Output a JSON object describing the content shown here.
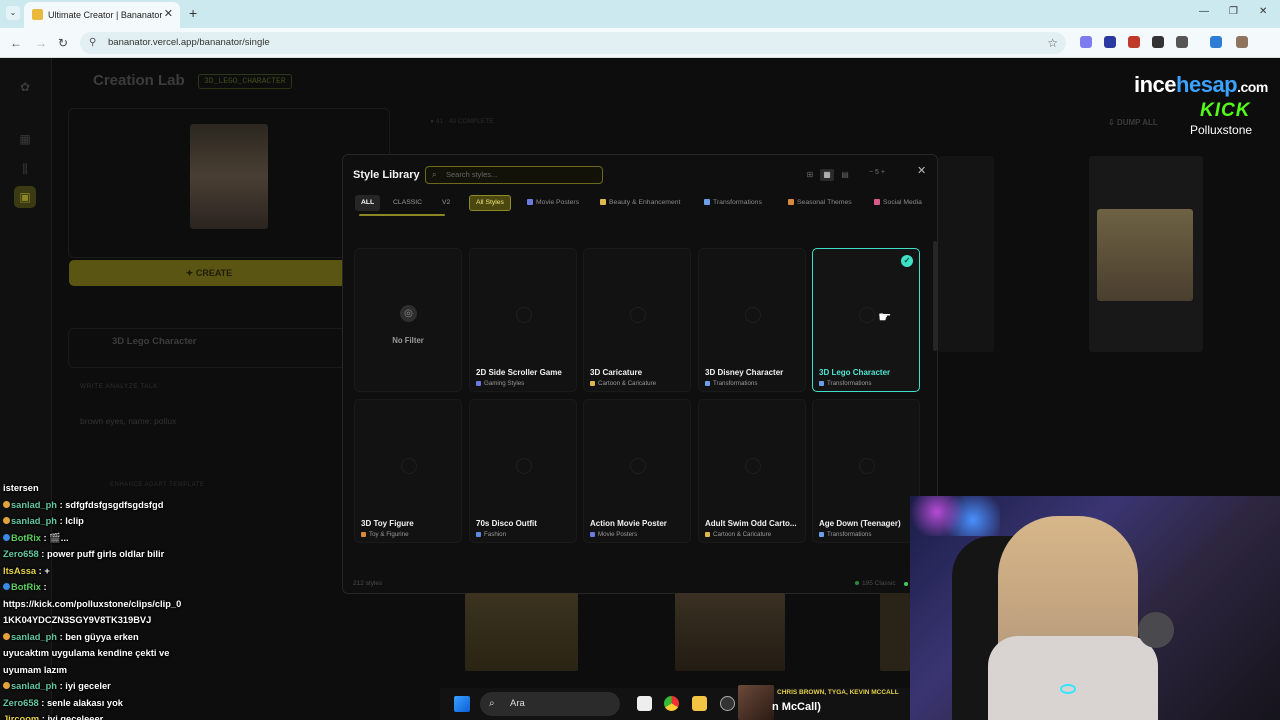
{
  "browser": {
    "tab_title": "Ultimate Creator | Bananator",
    "url": "bananator.vercel.app/bananator/single",
    "new_tab": "+",
    "tab_close": "✕",
    "menu_glyph": "⌄",
    "minimize": "—",
    "restore": "❐",
    "close": "✕",
    "back_icon": "←",
    "forward_icon": "→",
    "reload_icon": "↻",
    "tune_icon": "⚲",
    "star_icon": "☆",
    "extension_colors": [
      "#7c7cf0",
      "#2a3aa0",
      "#c0392b",
      "#333333",
      "#555555",
      "#2e7dd6",
      "#8d7560"
    ]
  },
  "lab": {
    "title": "Creation Lab",
    "badge": "3D_LEGO_CHARACTER",
    "create_label": "✦  CREATE",
    "style_name": "3D Lego Character",
    "tabs": "WRITE        ANALYZE        TALK",
    "prompt": "brown eyes, name: pollux",
    "tools": "ENHANCE                                           ADAPT                                   TEMPLATE",
    "gallery_meta": "● 41  ·  43  COMPLETE",
    "dump_all": "⇩  DUMP ALL"
  },
  "overlay": {
    "brand_a": "ince",
    "brand_b": "hesap",
    "brand_c": ".com",
    "kick": "KICK",
    "streamer": "Polluxstone"
  },
  "modal": {
    "title": "Style Library",
    "search_placeholder": "Search styles...",
    "search_icon": "⌕",
    "close": "✕",
    "view_small": "⊞",
    "view_medium": "▦",
    "view_list": "▤",
    "stepper": "−   5   +",
    "filters": [
      "ALL",
      "CLASSIC",
      "V2"
    ],
    "all_styles": "All Styles",
    "categories": [
      {
        "label": "Movie Posters",
        "color": "#6c7ae0"
      },
      {
        "label": "Beauty & Enhancement",
        "color": "#e0b84a"
      },
      {
        "label": "Transformations",
        "color": "#6aa0e8"
      },
      {
        "label": "Seasonal Themes",
        "color": "#d88a3a"
      },
      {
        "label": "Social Media",
        "color": "#d85a8a"
      }
    ],
    "no_filter": "No Filter",
    "no_filter_icon": "◎",
    "check_icon": "✓",
    "cards_row1": [
      {
        "title": "2D Side Scroller Game",
        "category": "Gaming Styles",
        "color": "#6c7ae0"
      },
      {
        "title": "3D Caricature",
        "category": "Cartoon & Caricature",
        "color": "#e0b84a"
      },
      {
        "title": "3D Disney Character",
        "category": "Transformations",
        "color": "#6aa0e8"
      },
      {
        "title": "3D Lego Character",
        "category": "Transformations",
        "color": "#6aa0e8"
      }
    ],
    "cards_row2": [
      {
        "title": "3D Toy Figure",
        "category": "Toy & Figurine",
        "color": "#d88a3a"
      },
      {
        "title": "70s Disco Outfit",
        "category": "Fashion",
        "color": "#5a8ae0"
      },
      {
        "title": "Action Movie Poster",
        "category": "Movie Posters",
        "color": "#6c7ae0"
      },
      {
        "title": "Adult Swim Odd Carto...",
        "category": "Cartoon & Caricature",
        "color": "#e0b84a"
      },
      {
        "title": "Age Down (Teenager)",
        "category": "Transformations",
        "color": "#6aa0e8"
      }
    ],
    "footer_count": "212 styles",
    "footer_right": "195 Classic"
  },
  "chat": [
    {
      "user": "",
      "text": "istersen"
    },
    {
      "user": "sanlad_ph",
      "text": "sdfgfdsfgsgdfsgdsfgd",
      "cls": "user",
      "badge": "#e6a23a"
    },
    {
      "user": "sanlad_ph",
      "text": "lclip",
      "cls": "user",
      "badge": "#e6a23a"
    },
    {
      "user": "BotRix",
      "text": "🎬...",
      "cls": "user bot",
      "badge": "#3a8ae6"
    },
    {
      "user": "Zero658",
      "text": "power puff girls oldlar bilir",
      "cls": "user",
      "badge": ""
    },
    {
      "user": "ItsAssa",
      "text": "+",
      "cls": "user yel",
      "badge": ""
    },
    {
      "user": "BotRix",
      "text": "",
      "cls": "user bot",
      "badge": "#3a8ae6"
    },
    {
      "user": "",
      "text": "https://kick.com/polluxstone/clips/clip_0"
    },
    {
      "user": "",
      "text": "1KK04YDCZN3SGY9V8TK319BVJ"
    },
    {
      "user": "sanlad_ph",
      "text": "ben güyya erken",
      "cls": "user",
      "badge": "#e6a23a"
    },
    {
      "user": "",
      "text": "uyucaktım uygulama kendine çekti ve"
    },
    {
      "user": "",
      "text": "uyumam lazım"
    },
    {
      "user": "sanlad_ph",
      "text": "iyi geceler",
      "cls": "user",
      "badge": "#e6a23a"
    },
    {
      "user": "Zero658",
      "text": "senle alakası yok",
      "cls": "user",
      "badge": ""
    },
    {
      "user": "Jircoom",
      "text": "iyi geceleeer",
      "cls": "user yel",
      "badge": ""
    }
  ],
  "taskbar": {
    "search": "Ara",
    "search_icon": "⌕",
    "music_artist": "CHRIS BROWN, TYGA, KEVIN MCCALL",
    "music_song": "n McCall)"
  }
}
